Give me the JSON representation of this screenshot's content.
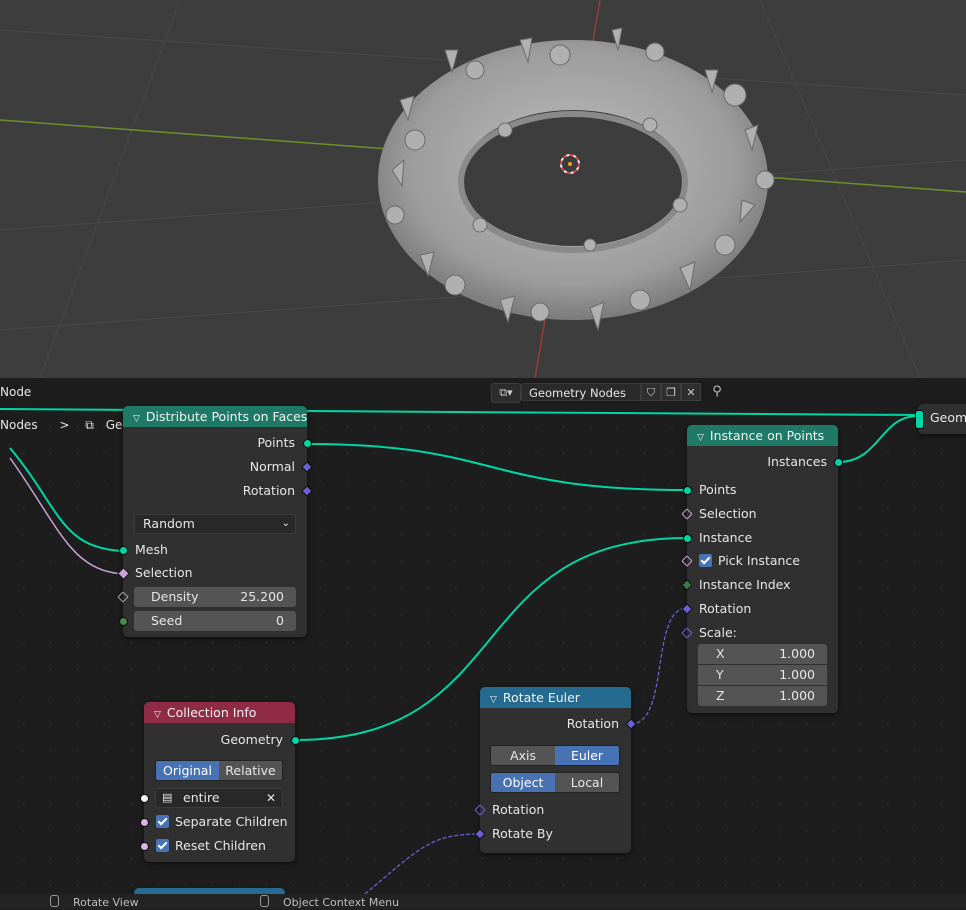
{
  "viewport": {
    "description": "3D viewport"
  },
  "editor_header": {
    "left_label": "Node",
    "tree_name": "Geometry Nodes",
    "right_output_label": "Geome"
  },
  "breadcrumb": {
    "parent": "Nodes",
    "separator": ">",
    "current": "Geometry Nodes"
  },
  "nodes": {
    "distribute": {
      "title": "Distribute Points on Faces",
      "out_points": "Points",
      "out_normal": "Normal",
      "out_rotation": "Rotation",
      "mode": "Random",
      "in_mesh": "Mesh",
      "in_selection": "Selection",
      "density_label": "Density",
      "density_value": "25.200",
      "seed_label": "Seed",
      "seed_value": "0"
    },
    "instance_on_points": {
      "title": "Instance on Points",
      "out_instances": "Instances",
      "in_points": "Points",
      "in_selection": "Selection",
      "in_instance": "Instance",
      "pick_instance": "Pick Instance",
      "instance_index": "Instance Index",
      "in_rotation": "Rotation",
      "scale_label": "Scale:",
      "scale_x_label": "X",
      "scale_x": "1.000",
      "scale_y_label": "Y",
      "scale_y": "1.000",
      "scale_z_label": "Z",
      "scale_z": "1.000"
    },
    "collection_info": {
      "title": "Collection Info",
      "out_geometry": "Geometry",
      "mode_original": "Original",
      "mode_relative": "Relative",
      "collection": "entire",
      "separate_children": "Separate Children",
      "reset_children": "Reset Children"
    },
    "rotate_euler": {
      "title": "Rotate Euler",
      "out_rotation": "Rotation",
      "type_axis_angle": "Axis Angle",
      "type_euler": "Euler",
      "space_object": "Object",
      "space_local": "Local",
      "in_rotation": "Rotation",
      "in_rotate_by": "Rotate By"
    }
  },
  "statusbar": {
    "left": "Rotate View",
    "middle": "Object Context Menu"
  },
  "colors": {
    "geometry_header": "#1e7a67",
    "input_header": "#8f2b45",
    "vector_header": "#256b8f",
    "geometry_socket": "#00d6a3",
    "vector_socket": "#6a5fd6",
    "accent": "#4772b3"
  }
}
